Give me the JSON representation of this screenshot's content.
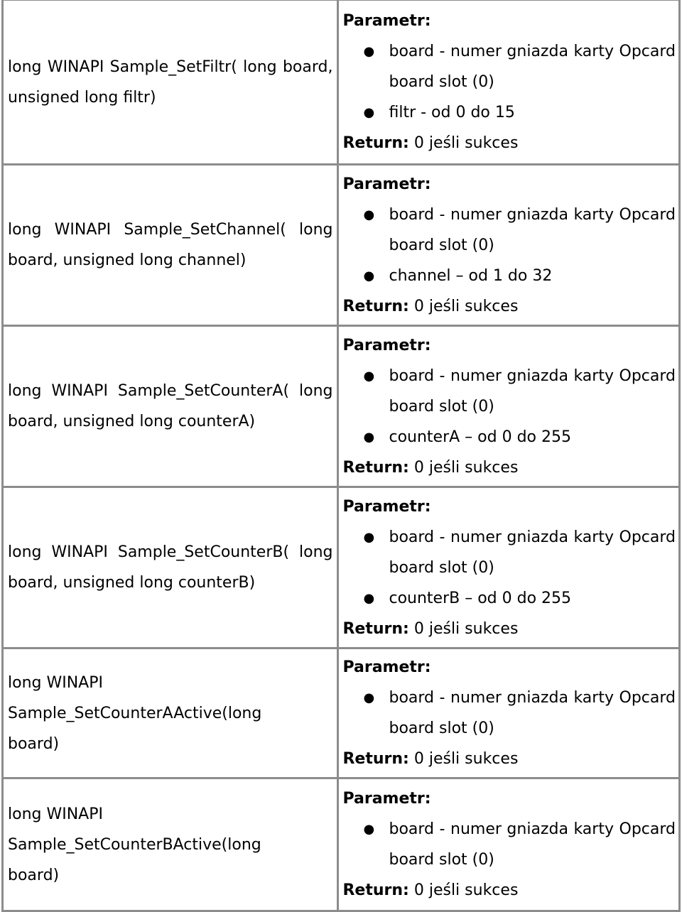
{
  "labels": {
    "parametr": "Parametr:",
    "return": "Return:",
    "bullet": "●"
  },
  "rows": [
    {
      "signature": "long WINAPI Sample_SetFiltr( long board, unsigned long filtr)",
      "params": [
        "board - numer gniazda karty Opcard board slot (0)",
        "filtr - od 0 do 15"
      ],
      "return": "0 jeśli sukces"
    },
    {
      "signature": "long WINAPI Sample_SetChannel( long board, unsigned long channel)",
      "params": [
        "board - numer gniazda karty Opcard board slot (0)",
        "channel – od 1 do 32"
      ],
      "return": "0 jeśli sukces"
    },
    {
      "signature": "long WINAPI Sample_SetCounterA( long board, unsigned long counterA)",
      "params": [
        "board - numer gniazda karty Opcard board slot (0)",
        "counterA – od 0 do 255"
      ],
      "return": "0 jeśli sukces"
    },
    {
      "signature": "long WINAPI Sample_SetCounterB( long board, unsigned long counterB)",
      "params": [
        "board - numer gniazda karty Opcard board slot (0)",
        "counterB – od 0 do 255"
      ],
      "return": "0 jeśli sukces"
    },
    {
      "signature_lines": [
        "long WINAPI",
        "Sample_SetCounterAActive(long",
        "board)"
      ],
      "params": [
        "board - numer gniazda karty Opcard board slot (0)"
      ],
      "return": "0 jeśli sukces"
    },
    {
      "signature_lines": [
        "long WINAPI",
        "Sample_SetCounterBActive(long",
        "board)"
      ],
      "params": [
        "board - numer gniazda karty Opcard board slot (0)"
      ],
      "return": "0 jeśli sukces"
    }
  ]
}
